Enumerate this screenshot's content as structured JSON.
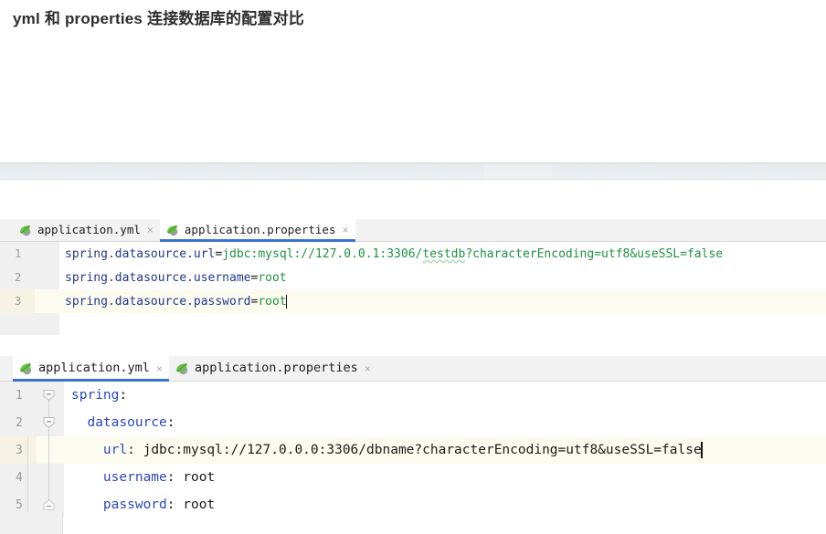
{
  "page": {
    "title": "yml 和 properties 连接数据库的配置对比"
  },
  "colors": {
    "accent_tab_underline": "#3a74d0",
    "key_token": "#23388c",
    "value_token": "#1f9142",
    "plain_token": "#1b1b1b",
    "gutter_bg": "#f0f0f0",
    "caret_line_bg": "#fcfbf0",
    "tabbar_bg": "#f2f2f2",
    "band_bg": "#e9ecee"
  },
  "editors": [
    {
      "id": "properties",
      "tabs": [
        {
          "label": "application.yml",
          "icon": "spring-leaf-icon",
          "active": false,
          "close": "×"
        },
        {
          "label": "application.properties",
          "icon": "spring-leaf-icon",
          "active": true,
          "close": "×"
        }
      ],
      "language": "properties",
      "lines": [
        {
          "number": "1",
          "caret_line": false,
          "text": "spring.datasource.url=jdbc:mysql://127.0.0.1:3306/testdb?characterEncoding=utf8&useSSL=false",
          "key": "spring.datasource.url",
          "eq": "=",
          "value_a": "jdbc:mysql://127.0.0.1:3306/",
          "value_warn": "testdb",
          "value_b": "?characterEncoding=utf8&useSSL=false"
        },
        {
          "number": "2",
          "caret_line": false,
          "text": "spring.datasource.username=root",
          "key": "spring.datasource.username",
          "eq": "=",
          "value_a": "root"
        },
        {
          "number": "3",
          "caret_line": true,
          "text": "spring.datasource.password=root",
          "key": "spring.datasource.password",
          "eq": "=",
          "value_a": "root"
        }
      ]
    },
    {
      "id": "yml",
      "tabs": [
        {
          "label": "application.yml",
          "icon": "spring-leaf-icon",
          "active": true,
          "close": "×"
        },
        {
          "label": "application.properties",
          "icon": "spring-leaf-icon",
          "active": false,
          "close": "×"
        }
      ],
      "language": "yaml",
      "lines": [
        {
          "number": "1",
          "caret_line": false,
          "fold": "collapse",
          "indent": "",
          "key": "spring",
          "colon": ":",
          "value": "",
          "text": "spring:"
        },
        {
          "number": "2",
          "caret_line": false,
          "fold": "collapse",
          "indent": "  ",
          "key": "datasource",
          "colon": ":",
          "value": "",
          "text": "  datasource:"
        },
        {
          "number": "3",
          "caret_line": true,
          "fold": "",
          "indent": "    ",
          "key": "url",
          "colon": ":",
          "value": " jdbc:mysql://127.0.0.0:3306/dbname?characterEncoding=utf8&useSSL=false",
          "text": "    url: jdbc:mysql://127.0.0.0:3306/dbname?characterEncoding=utf8&useSSL=false"
        },
        {
          "number": "4",
          "caret_line": false,
          "fold": "",
          "indent": "    ",
          "key": "username",
          "colon": ":",
          "value": " root",
          "text": "    username: root"
        },
        {
          "number": "5",
          "caret_line": false,
          "fold": "end",
          "indent": "    ",
          "key": "password",
          "colon": ":",
          "value": " root",
          "text": "    password: root"
        }
      ]
    }
  ]
}
